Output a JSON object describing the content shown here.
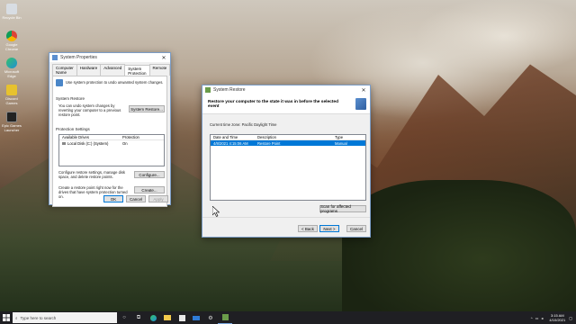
{
  "desktop": {
    "icons": [
      {
        "label": "Recycle Bin",
        "icon": "recycle-bin-icon",
        "color": "#d8dde3"
      },
      {
        "label": "Google Chrome",
        "icon": "chrome-icon",
        "color": "#e8b030"
      },
      {
        "label": "Microsoft Edge",
        "icon": "edge-icon",
        "color": "#1f8fd4"
      },
      {
        "label": "Discord Games",
        "icon": "game-icon",
        "color": "#e7c22e"
      },
      {
        "label": "Epic Games Launcher",
        "icon": "epic-games-icon",
        "color": "#222222"
      }
    ]
  },
  "system_properties": {
    "title": "System Properties",
    "tabs": [
      "Computer Name",
      "Hardware",
      "Advanced",
      "System Protection",
      "Remote"
    ],
    "active_tab": "System Protection",
    "intro": "Use system protection to undo unwanted system changes.",
    "restore_group_label": "System Restore",
    "restore_text": "You can undo system changes by reverting your computer to a previous restore point.",
    "restore_button": "System Restore...",
    "protection_group_label": "Protection Settings",
    "columns": [
      "Available Drives",
      "Protection"
    ],
    "drives": [
      {
        "name": "Local Disk (C:) (System)",
        "protection": "On"
      }
    ],
    "configure_text": "Configure restore settings, manage disk space, and delete restore points.",
    "configure_button": "Configure...",
    "create_text": "Create a restore point right now for the drives that have system protection turned on.",
    "create_button": "Create...",
    "ok": "OK",
    "cancel": "Cancel",
    "apply": "Apply"
  },
  "system_restore": {
    "title": "System Restore",
    "heading": "Restore your computer to the state it was in before the selected event",
    "timezone": "Current time zone: Pacific Daylight Time",
    "columns": [
      "Date and Time",
      "Description",
      "Type"
    ],
    "rows": [
      {
        "date": "4/8/2021 4:15:06 AM",
        "description": "Restore Point",
        "type": "Manual"
      }
    ],
    "scan_button": "Scan for affected programs",
    "back": "< Back",
    "next": "Next >",
    "cancel": "Cancel"
  },
  "taskbar": {
    "search_placeholder": "Type here to search",
    "time": "3:15 AM",
    "date": "4/10/2021"
  },
  "colors": {
    "accent": "#0078d7",
    "taskbar": "#1f1f23"
  }
}
